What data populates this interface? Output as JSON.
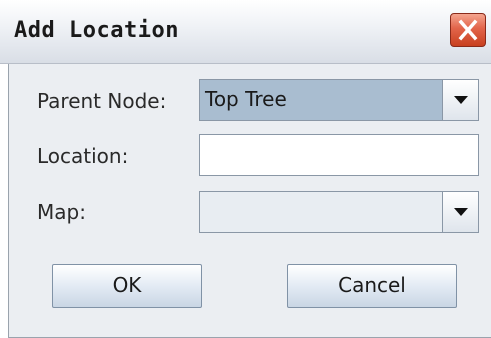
{
  "dialog": {
    "title": "Add Location",
    "close_icon": "close-icon"
  },
  "form": {
    "parent_node": {
      "label": "Parent Node:",
      "value": "Top Tree"
    },
    "location": {
      "label": "Location:",
      "value": ""
    },
    "map": {
      "label": "Map:",
      "value": ""
    }
  },
  "buttons": {
    "ok_label": "OK",
    "cancel_label": "Cancel"
  },
  "colors": {
    "selected_combo": "#a9bdd0",
    "close_button": "#d9533a"
  }
}
